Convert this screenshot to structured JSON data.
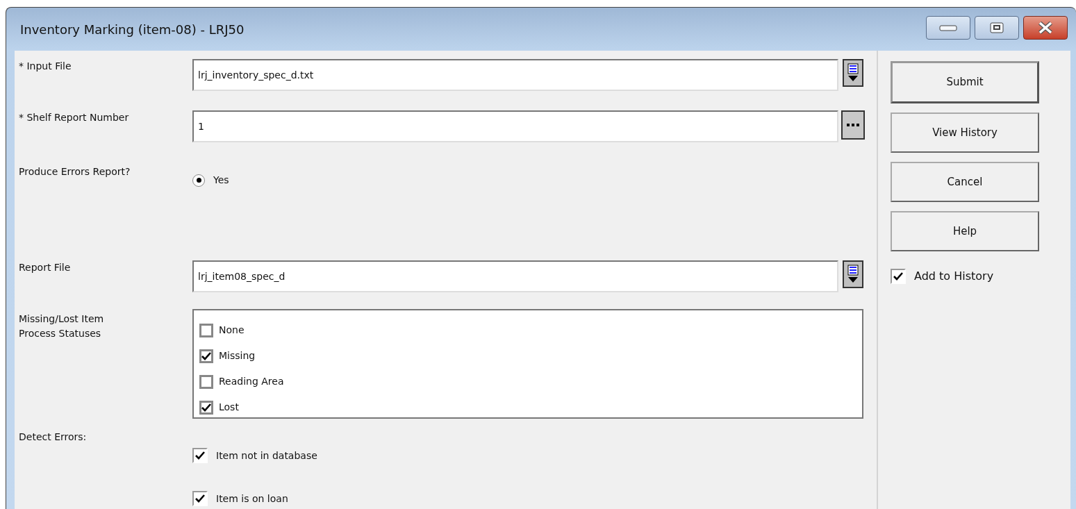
{
  "window": {
    "title": "Inventory Marking (item-08) - LRJ50"
  },
  "form": [
    {
      "kind": "file",
      "label": "* Input File",
      "value": "lrj_inventory_spec_d.txt"
    },
    {
      "kind": "lookup",
      "label": "* Shelf Report Number",
      "value": "1"
    },
    {
      "kind": "radio",
      "label": "Produce Errors Report?",
      "options": [
        {
          "label": "Yes",
          "selected": true
        }
      ]
    },
    {
      "kind": "file",
      "label": "Report File",
      "value": "lrj_item08_spec_d"
    },
    {
      "kind": "checklist",
      "label": "Missing/Lost Item Process Statuses",
      "items": [
        {
          "label": "None",
          "checked": false
        },
        {
          "label": "Missing",
          "checked": true
        },
        {
          "label": "Reading Area",
          "checked": false
        },
        {
          "label": "Lost",
          "checked": true
        }
      ]
    },
    {
      "kind": "checks",
      "label": "Detect Errors:",
      "items": [
        {
          "label": "Item not in database",
          "checked": true
        },
        {
          "label": "Item is on loan",
          "checked": true
        }
      ]
    }
  ],
  "buttons": [
    {
      "label": "Submit",
      "default": true
    },
    {
      "label": "View History",
      "default": false
    },
    {
      "label": "Cancel",
      "default": false
    },
    {
      "label": "Help",
      "default": false
    }
  ],
  "add_to_history": {
    "label": "Add to History",
    "checked": true
  }
}
